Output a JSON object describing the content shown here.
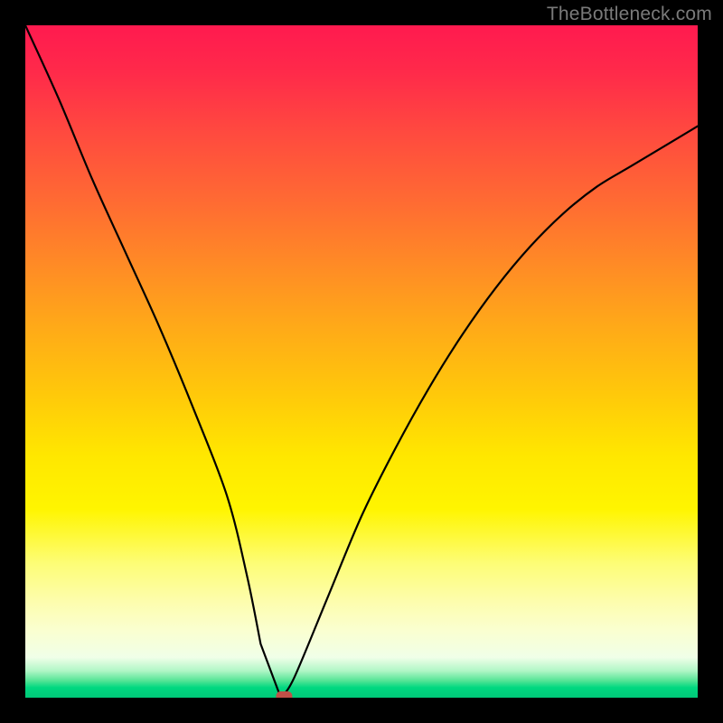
{
  "watermark": "TheBottleneck.com",
  "chart_data": {
    "type": "line",
    "title": "",
    "xlabel": "",
    "ylabel": "",
    "xlim": [
      0,
      100
    ],
    "ylim": [
      0,
      100
    ],
    "grid": false,
    "series": [
      {
        "name": "bottleneck-curve",
        "x": [
          0,
          5,
          10,
          15,
          20,
          25,
          30,
          33,
          35,
          37,
          38,
          40,
          45,
          50,
          55,
          60,
          65,
          70,
          75,
          80,
          85,
          90,
          95,
          100
        ],
        "values": [
          100,
          89,
          77,
          66,
          55,
          43,
          30,
          18,
          8,
          0,
          0,
          3,
          15,
          27,
          37,
          46,
          54,
          61,
          67,
          72,
          76,
          79,
          82,
          85
        ]
      }
    ],
    "flat_segment": {
      "x_start": 35,
      "x_end": 38,
      "y": 0
    },
    "marker": {
      "x": 38.5,
      "y": 0,
      "shape": "rounded-rect",
      "color": "#c05048"
    },
    "background_gradient": {
      "direction": "vertical",
      "stops": [
        {
          "pos": 0.0,
          "color": "#ff1a4f"
        },
        {
          "pos": 0.5,
          "color": "#ffc90a"
        },
        {
          "pos": 0.78,
          "color": "#fff500"
        },
        {
          "pos": 0.95,
          "color": "#b0f6c6"
        },
        {
          "pos": 1.0,
          "color": "#00c878"
        }
      ]
    }
  }
}
